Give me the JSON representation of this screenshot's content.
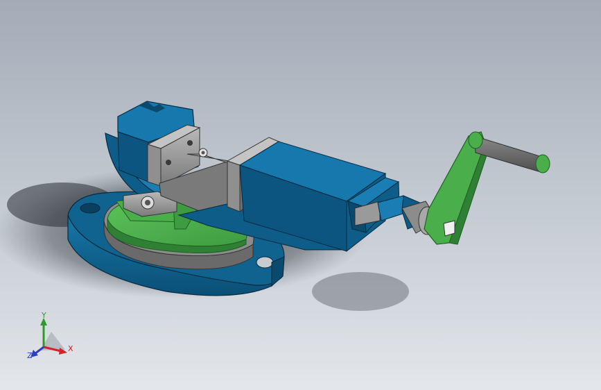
{
  "viewport": {
    "background_top": "#a3abb7",
    "background_bottom": "#e3e6ea"
  },
  "model": {
    "colors": {
      "body_blue": "#0e5c86",
      "body_blue_dark": "#073f60",
      "body_blue_light": "#1d7ab0",
      "green": "#4aae4a",
      "green_dark": "#2f7f34",
      "steel_gray": "#9a9a9a",
      "steel_dark": "#5c5c5c",
      "handle_gray": "#6e6e6e"
    }
  },
  "triad": {
    "x_label": "X",
    "y_label": "Y",
    "z_label": "Z",
    "x_color": "#d6202a",
    "y_color": "#2f9a2f",
    "z_color": "#2b3fbf"
  }
}
